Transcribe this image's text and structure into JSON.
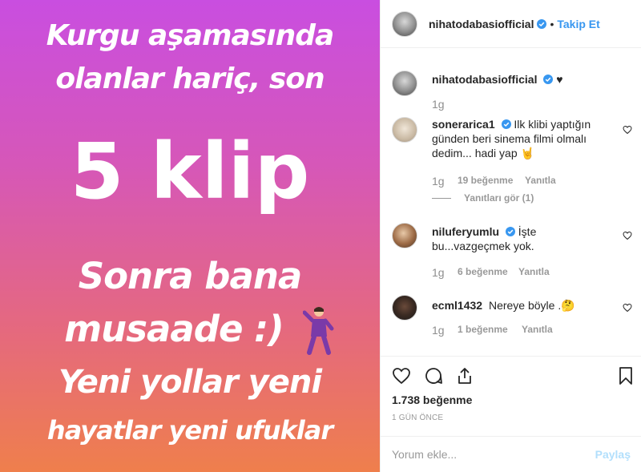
{
  "image_text": {
    "line1": "Kurgu aşamasında",
    "line2": "olanlar hariç, son",
    "line3": "5 klip",
    "line4": "Sonra bana",
    "line5": "musaade :)",
    "line6": "Yeni yollar yeni",
    "line7": "hayatlar yeni ufuklar"
  },
  "header": {
    "username": "nihatodabasiofficial",
    "separator": "•",
    "follow_label": "Takip Et"
  },
  "caption": {
    "username": "nihatodabasiofficial",
    "text": "♥",
    "time": "1g"
  },
  "comments": [
    {
      "username": "sonerarica1",
      "text": "Ilk klibi yaptığın günden beri sinema filmi olmalı dedim... hadi yap 🤘",
      "time": "1g",
      "likes": "19 beğenme",
      "reply": "Yanıtla",
      "view_replies": "Yanıtları gör (1)"
    },
    {
      "username": "niluferyumlu",
      "text": "İşte bu...vazgeçmek yok.",
      "time": "1g",
      "likes": "6 beğenme",
      "reply": "Yanıtla"
    },
    {
      "username": "ecml1432",
      "text": "Nereye böyle .🤔",
      "time": "1g",
      "likes": "1 beğenme",
      "reply": "Yanıtla"
    }
  ],
  "stats": {
    "likes": "1.738 beğenme",
    "time_ago": "1 GÜN ÖNCE"
  },
  "add_comment": {
    "placeholder": "Yorum ekle...",
    "post_label": "Paylaş"
  },
  "colors": {
    "link_blue": "#3897f0",
    "verified_blue": "#3897f0",
    "muted": "#999999"
  }
}
